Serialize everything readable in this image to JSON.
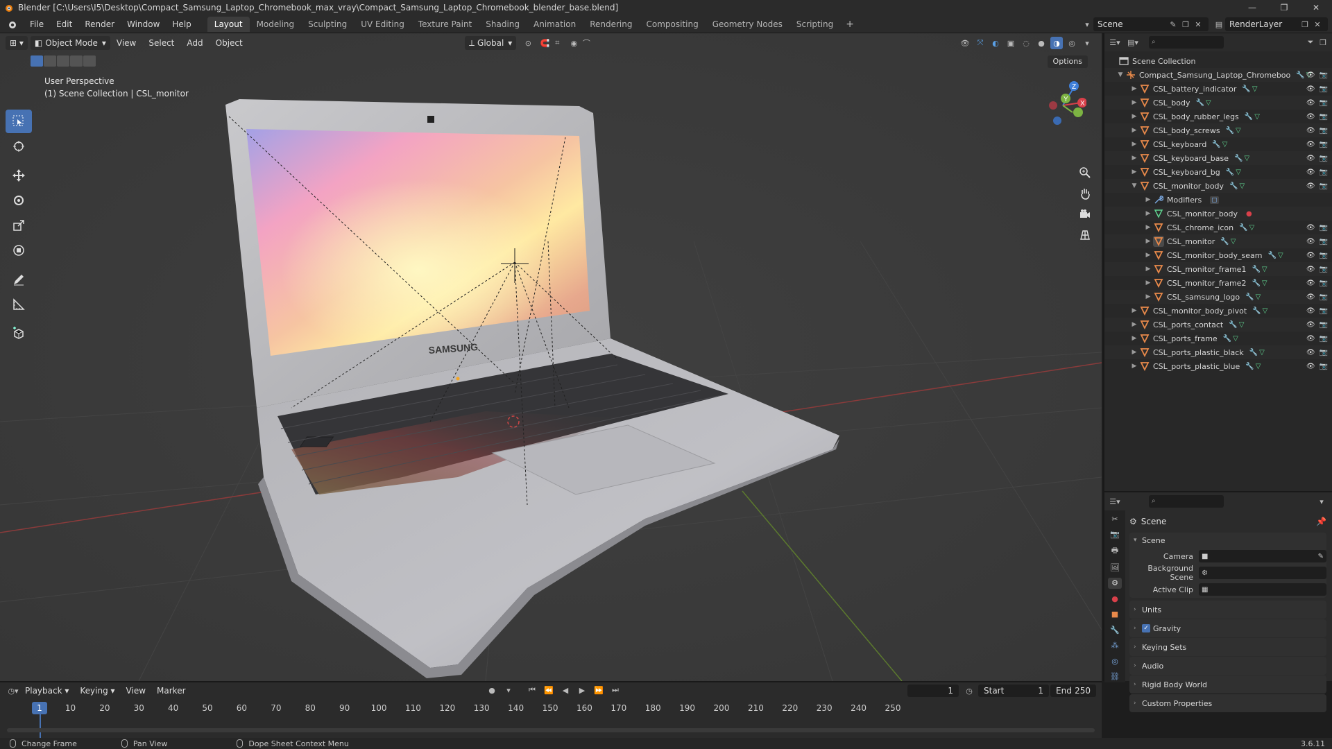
{
  "window": {
    "title": "Blender [C:\\Users\\I5\\Desktop\\Compact_Samsung_Laptop_Chromebook_max_vray\\Compact_Samsung_Laptop_Chromebook_blender_base.blend]",
    "controls": [
      "—",
      "❐",
      "✕"
    ]
  },
  "menu": [
    "File",
    "Edit",
    "Render",
    "Window",
    "Help"
  ],
  "workspaces": [
    "Layout",
    "Modeling",
    "Sculpting",
    "UV Editing",
    "Texture Paint",
    "Shading",
    "Animation",
    "Rendering",
    "Compositing",
    "Geometry Nodes",
    "Scripting"
  ],
  "top_right": {
    "scene": "Scene",
    "view_layer": "RenderLayer"
  },
  "viewport": {
    "mode": "Object Mode",
    "menus": [
      "View",
      "Select",
      "Add",
      "Object"
    ],
    "transform_orientation": "Global",
    "options": "Options",
    "info_line1": "User Perspective",
    "info_line2": "(1) Scene Collection | CSL_monitor",
    "brand_text": "SAMSUNG",
    "gizmo_axes": [
      "X",
      "Y",
      "Z"
    ]
  },
  "outliner": {
    "root": "Scene Collection",
    "items": [
      {
        "label": "Compact_Samsung_Laptop_Chromeboo",
        "indent": 1,
        "expanded": true,
        "type": "empty"
      },
      {
        "label": "CSL_battery_indicator",
        "indent": 2,
        "type": "mesh"
      },
      {
        "label": "CSL_body",
        "indent": 2,
        "type": "mesh"
      },
      {
        "label": "CSL_body_rubber_legs",
        "indent": 2,
        "type": "mesh"
      },
      {
        "label": "CSL_body_screws",
        "indent": 2,
        "type": "mesh"
      },
      {
        "label": "CSL_keyboard",
        "indent": 2,
        "type": "mesh"
      },
      {
        "label": "CSL_keyboard_base",
        "indent": 2,
        "type": "mesh"
      },
      {
        "label": "CSL_keyboard_bg",
        "indent": 2,
        "type": "mesh"
      },
      {
        "label": "CSL_monitor_body",
        "indent": 2,
        "expanded": true,
        "type": "mesh"
      },
      {
        "label": "Modifiers",
        "indent": 3,
        "type": "modifiers"
      },
      {
        "label": "CSL_monitor_body",
        "indent": 3,
        "type": "meshdata"
      },
      {
        "label": "CSL_chrome_icon",
        "indent": 3,
        "type": "mesh"
      },
      {
        "label": "CSL_monitor",
        "indent": 3,
        "type": "mesh",
        "active": true
      },
      {
        "label": "CSL_monitor_body_seam",
        "indent": 3,
        "type": "mesh"
      },
      {
        "label": "CSL_monitor_frame1",
        "indent": 3,
        "type": "mesh"
      },
      {
        "label": "CSL_monitor_frame2",
        "indent": 3,
        "type": "mesh"
      },
      {
        "label": "CSL_samsung_logo",
        "indent": 3,
        "type": "mesh"
      },
      {
        "label": "CSL_monitor_body_pivot",
        "indent": 2,
        "type": "mesh"
      },
      {
        "label": "CSL_ports_contact",
        "indent": 2,
        "type": "mesh"
      },
      {
        "label": "CSL_ports_frame",
        "indent": 2,
        "type": "mesh"
      },
      {
        "label": "CSL_ports_plastic_black",
        "indent": 2,
        "type": "mesh"
      },
      {
        "label": "CSL_ports_plastic_blue",
        "indent": 2,
        "type": "mesh"
      }
    ]
  },
  "properties": {
    "context": "Scene",
    "panel_title": "Scene",
    "camera_label": "Camera",
    "background_scene_label": "Background Scene",
    "active_clip_label": "Active Clip",
    "subpanels": [
      "Units",
      "Gravity",
      "Keying Sets",
      "Audio",
      "Rigid Body World",
      "Custom Properties"
    ],
    "gravity_checked": true
  },
  "timeline": {
    "menus": [
      "Playback",
      "Keying",
      "View",
      "Marker"
    ],
    "current_frame": "1",
    "start_label": "Start",
    "start": "1",
    "end_label": "End",
    "end": "250",
    "ticks": [
      "10",
      "20",
      "30",
      "40",
      "50",
      "60",
      "70",
      "80",
      "90",
      "100",
      "110",
      "120",
      "130",
      "140",
      "150",
      "160",
      "170",
      "180",
      "190",
      "200",
      "210",
      "220",
      "230",
      "240",
      "250"
    ]
  },
  "status": {
    "change_frame": "Change Frame",
    "pan_view": "Pan View",
    "context_menu": "Dope Sheet Context Menu",
    "version": "3.6.11"
  },
  "colors": {
    "accent": "#4772b3",
    "mesh_icon": "#e8894a",
    "modifier_icon": "#7aa8e0",
    "data_icon": "#5fd38f",
    "x_axis": "#d9404a",
    "y_axis": "#7cb342",
    "z_axis": "#3f7fd9"
  }
}
